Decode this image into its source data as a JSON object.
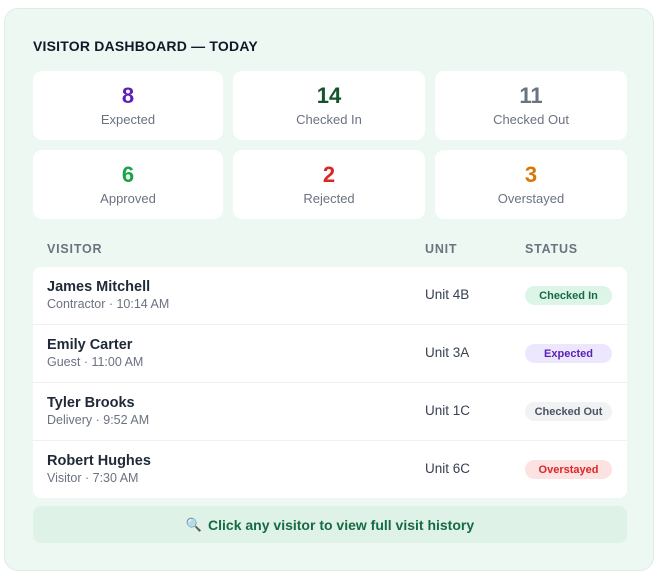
{
  "title": "VISITOR DASHBOARD — TODAY",
  "stats": [
    {
      "value": "8",
      "label": "Expected",
      "color": "#5b21b6"
    },
    {
      "value": "14",
      "label": "Checked In",
      "color": "#14532d"
    },
    {
      "value": "11",
      "label": "Checked Out",
      "color": "#6b7280"
    },
    {
      "value": "6",
      "label": "Approved",
      "color": "#16a34a"
    },
    {
      "value": "2",
      "label": "Rejected",
      "color": "#dc2626"
    },
    {
      "value": "3",
      "label": "Overstayed",
      "color": "#d97706"
    }
  ],
  "table": {
    "headers": {
      "visitor": "VISITOR",
      "unit": "UNIT",
      "status": "STATUS"
    },
    "rows": [
      {
        "name": "James Mitchell",
        "sub": "Contractor · 10:14 AM",
        "unit": "Unit 4B",
        "status": "Checked In",
        "status_bg": "#dcf5e7",
        "status_fg": "#166a44"
      },
      {
        "name": "Emily Carter",
        "sub": "Guest · 11:00 AM",
        "unit": "Unit 3A",
        "status": "Expected",
        "status_bg": "#ede7fd",
        "status_fg": "#5b21b6"
      },
      {
        "name": "Tyler Brooks",
        "sub": "Delivery · 9:52 AM",
        "unit": "Unit 1C",
        "status": "Checked Out",
        "status_bg": "#f1f2f4",
        "status_fg": "#4b5563"
      },
      {
        "name": "Robert Hughes",
        "sub": "Visitor · 7:30 AM",
        "unit": "Unit 6C",
        "status": "Overstayed",
        "status_bg": "#fde2e2",
        "status_fg": "#dc2626"
      }
    ]
  },
  "footer": {
    "icon": "magnifier-icon",
    "text": "Click any visitor to view full visit history"
  }
}
